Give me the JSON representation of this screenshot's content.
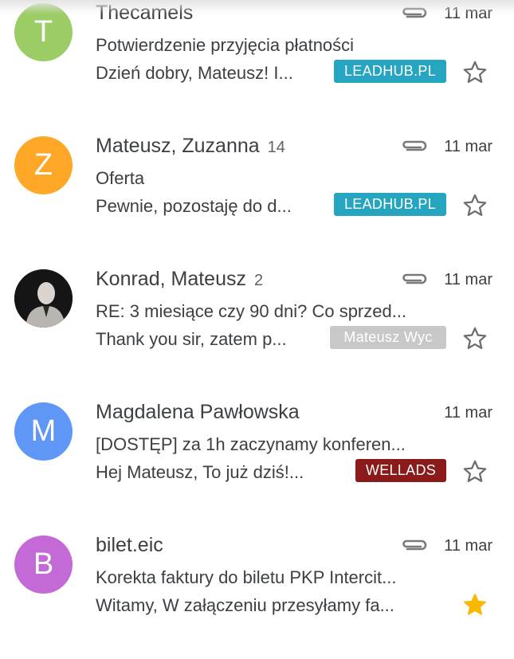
{
  "emails": [
    {
      "avatar_letter": "T",
      "avatar_color": "#9ccc65",
      "sender": "Thecamels",
      "count": "",
      "has_attachment": true,
      "date": "11 mar",
      "subject": "Potwierdzenie przyjęcia płatności",
      "snippet": "Dzień dobry, Mateusz! I...",
      "label": "LEADHUB.PL",
      "label_color": "#26a5c0",
      "starred": false
    },
    {
      "avatar_letter": "Z",
      "avatar_color": "#ffa726",
      "sender": "Mateusz, Zuzanna",
      "count": "14",
      "has_attachment": true,
      "date": "11 mar",
      "subject": "Oferta",
      "snippet": "Pewnie, pozostaję do d...",
      "label": "LEADHUB.PL",
      "label_color": "#26a5c0",
      "starred": false
    },
    {
      "avatar_letter": "",
      "avatar_color": "#1b1b1b",
      "avatar_photo": true,
      "sender": "Konrad, Mateusz",
      "count": "2",
      "has_attachment": true,
      "date": "11 mar",
      "subject": "RE: 3 miesiące czy 90 dni? Co sprzed...",
      "snippet": "Thank you sir, zatem p...",
      "label": "Mateusz Wyc",
      "label_color": "#c8c8c8",
      "starred": false
    },
    {
      "avatar_letter": "M",
      "avatar_color": "#5e97f6",
      "sender": "Magdalena Pawłowska",
      "count": "",
      "has_attachment": false,
      "date": "11 mar",
      "subject": "[DOSTĘP] za 1h zaczynamy konferen...",
      "snippet": "Hej Mateusz, To już dziś!...",
      "label": "WELLADS",
      "label_color": "#8b1a1a",
      "starred": false
    },
    {
      "avatar_letter": "B",
      "avatar_color": "#c36ad6",
      "sender": "bilet.eic",
      "count": "",
      "has_attachment": true,
      "date": "11 mar",
      "subject": "Korekta faktury do biletu PKP Intercit...",
      "snippet": "Witamy, W załączeniu przesyłamy fa...",
      "label": "",
      "label_color": "",
      "starred": true
    }
  ]
}
